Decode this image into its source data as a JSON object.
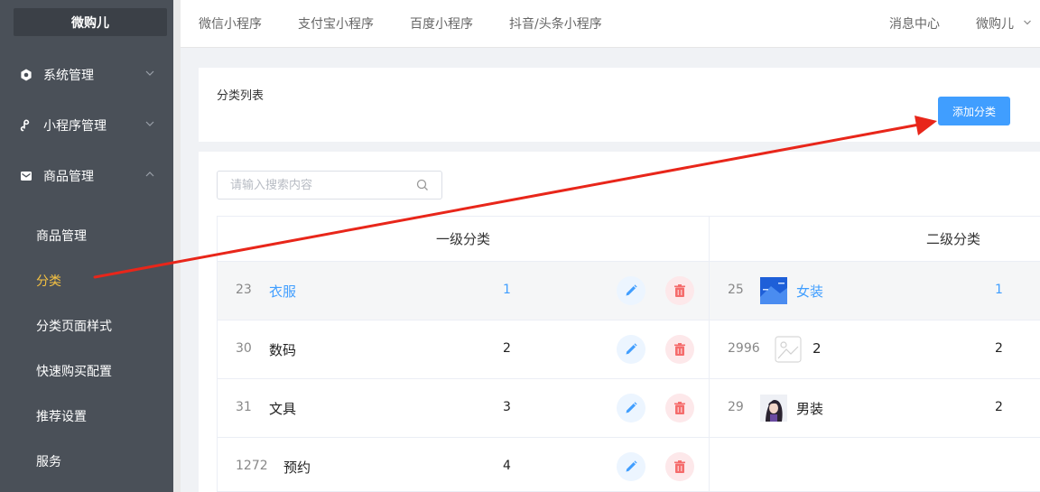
{
  "sidebar": {
    "brand": "微购儿",
    "groups": [
      {
        "label": "系统管理",
        "icon": "hexagon-icon"
      },
      {
        "label": "小程序管理",
        "icon": "link-icon"
      },
      {
        "label": "商品管理",
        "icon": "mail-icon"
      }
    ],
    "subitems": [
      {
        "label": "商品管理"
      },
      {
        "label": "分类"
      },
      {
        "label": "分类页面样式"
      },
      {
        "label": "快速购买配置"
      },
      {
        "label": "推荐设置"
      },
      {
        "label": "服务"
      }
    ]
  },
  "topbar": {
    "tabs": [
      "微信小程序",
      "支付宝小程序",
      "百度小程序",
      "抖音/头条小程序"
    ],
    "messages": "消息中心",
    "user": "微购儿"
  },
  "page": {
    "title": "分类列表",
    "add_button": "添加分类"
  },
  "search": {
    "placeholder": "请输入搜索内容"
  },
  "level1": {
    "header": "一级分类",
    "rows": [
      {
        "id": "23",
        "name": "衣服",
        "sort": "1"
      },
      {
        "id": "30",
        "name": "数码",
        "sort": "2"
      },
      {
        "id": "31",
        "name": "文具",
        "sort": "3"
      },
      {
        "id": "1272",
        "name": "预约",
        "sort": "4"
      }
    ]
  },
  "level2": {
    "header": "二级分类",
    "rows": [
      {
        "id": "25",
        "name": "女装",
        "sort": "1",
        "thumb": "blue-image"
      },
      {
        "id": "2996",
        "name": "2",
        "sort": "2",
        "thumb": "placeholder-image"
      },
      {
        "id": "29",
        "name": "男装",
        "sort": "2",
        "thumb": "avatar-image"
      }
    ]
  },
  "colors": {
    "sidebar": "#4a5058",
    "active": "#f5c242",
    "primary": "#409eff",
    "danger": "#f56c6c",
    "arrow": "#e8261a"
  }
}
